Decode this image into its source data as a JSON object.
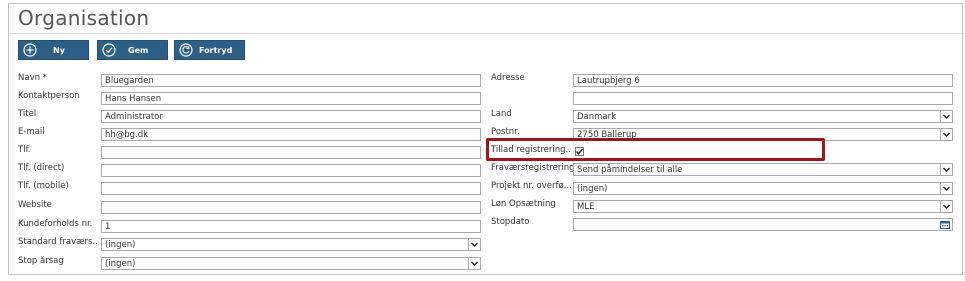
{
  "page": {
    "title": "Organisation"
  },
  "toolbar": {
    "new_label": "Ny",
    "save_label": "Gem",
    "undo_label": "Fortryd"
  },
  "left": {
    "name": {
      "label": "Navn *",
      "value": "Bluegarden"
    },
    "contact": {
      "label": "Kontaktperson",
      "value": "Hans Hansen"
    },
    "title": {
      "label": "Titel",
      "value": "Administrator"
    },
    "email": {
      "label": "E-mail",
      "value": "hh@bg.dk"
    },
    "phone": {
      "label": "Tlf.",
      "value": ""
    },
    "phone_direct": {
      "label": "Tlf. (direct)",
      "value": ""
    },
    "phone_mobile": {
      "label": "Tlf. (mobile)",
      "value": ""
    },
    "website": {
      "label": "Website",
      "value": ""
    },
    "customer_no": {
      "label": "Kundeforholds nr.",
      "value": "1"
    },
    "std_absence": {
      "label": "Standard fraværs...",
      "value": "(ingen)"
    },
    "stop_reason": {
      "label": "Stop årsag",
      "value": "(ingen)"
    }
  },
  "right": {
    "address": {
      "label": "Adresse",
      "value": "Lautrupbjerg 6",
      "value2": ""
    },
    "country": {
      "label": "Land",
      "value": "Danmark"
    },
    "postal": {
      "label": "Postnr.",
      "value": "2750 Ballerup"
    },
    "allow_reg": {
      "label": "Tillad registrering...",
      "checked": true
    },
    "absence_reg": {
      "label": "Fraværsregistrering",
      "value": "Send påmindelser til alle"
    },
    "project_transfer": {
      "label": "Projekt nr. overfø...",
      "value": "(ingen)"
    },
    "payroll": {
      "label": "Løn Opsætning",
      "value": "MLE"
    },
    "stop_date": {
      "label": "Stopdato",
      "value": ""
    }
  },
  "colors": {
    "button_bg": "#2e5f86",
    "highlight": "#a0141a",
    "checkmark": "#222222"
  }
}
